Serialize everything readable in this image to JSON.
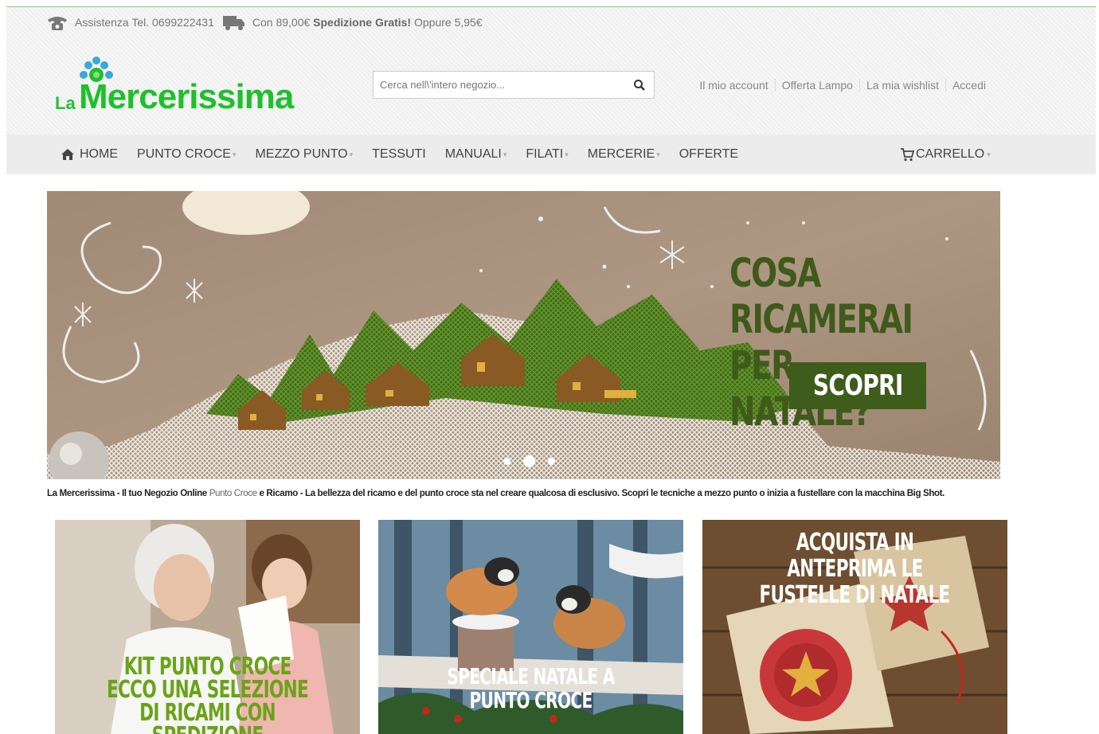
{
  "topbar": {
    "phone_label": "Assistenza Tel. 0699222431",
    "shipping_prefix": "Con 89,00€",
    "shipping_bold": "Spedizione Gratis!",
    "shipping_suffix": "Oppure 5,95€"
  },
  "logo": {
    "prefix": "La",
    "name": "Mercerissima"
  },
  "search": {
    "placeholder": "Cerca nell\\'intero negozio..."
  },
  "account_links": [
    "Il mio account",
    "Offerta Lampo",
    "La mia wishlist",
    "Accedi"
  ],
  "nav": {
    "items": [
      {
        "label": "HOME",
        "dropdown": false
      },
      {
        "label": "PUNTO CROCE",
        "dropdown": true
      },
      {
        "label": "MEZZO PUNTO",
        "dropdown": true
      },
      {
        "label": "TESSUTI",
        "dropdown": false
      },
      {
        "label": "MANUALI",
        "dropdown": true
      },
      {
        "label": "FILATI",
        "dropdown": true
      },
      {
        "label": "MERCERIE",
        "dropdown": true
      },
      {
        "label": "OFFERTE",
        "dropdown": false
      }
    ],
    "cart_label": "CARRELLO"
  },
  "banner": {
    "headline_line1": "COSA RICAMERAI",
    "headline_line2": "PER NATALE?",
    "button_label": "SCOPRI",
    "slides_count": 3,
    "active_slide": 2
  },
  "tagline": {
    "part1": "La Mercerissima - Il tuo Negozio Online ",
    "link": "Punto Croce",
    "part2": " e Ricamo - La bellezza del ricamo e del punto croce sta nel creare qualcosa di esclusivo. Scopri le tecniche a mezzo punto o inizia a fustellare con la macchina Big Shot."
  },
  "promos": [
    {
      "line1": "KIT PUNTO CROCE",
      "line2": "ECCO UNA SELEZIONE DI RICAMI CON",
      "line3": "SPEDIZIONE IMMEDIATA"
    },
    {
      "line1": "SPECIALE NATALE A PUNTO CROCE"
    },
    {
      "line1": "ACQUISTA IN ANTEPRIMA LE",
      "line2": "FUSTELLE DI NATALE"
    }
  ],
  "colors": {
    "brand_green": "#1fc02b",
    "banner_green": "#3e5d1a",
    "promo_green": "#6aa318",
    "nav_bg": "#ececec"
  }
}
